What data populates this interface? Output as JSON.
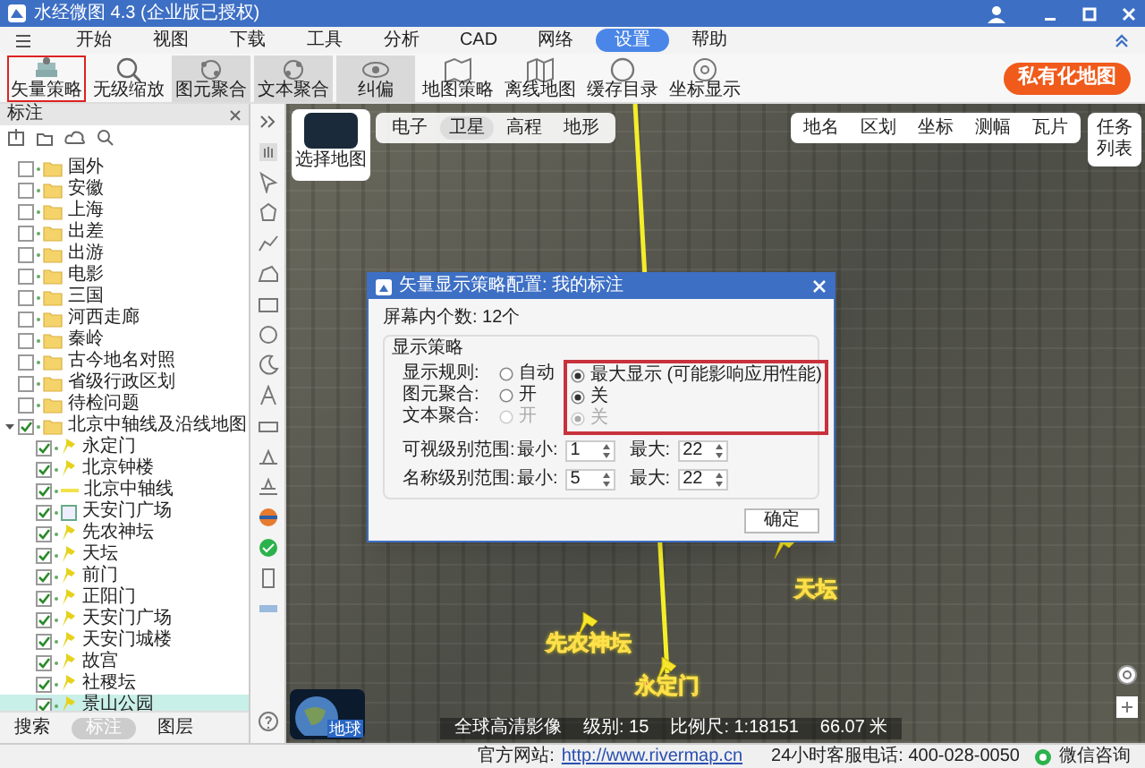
{
  "window": {
    "title": "水经微图 4.3 (企业版已授权)"
  },
  "menu": [
    {
      "label": "开始",
      "selected": false
    },
    {
      "label": "视图",
      "selected": false
    },
    {
      "label": "下载",
      "selected": false
    },
    {
      "label": "工具",
      "selected": false
    },
    {
      "label": "分析",
      "selected": false
    },
    {
      "label": "CAD",
      "selected": false
    },
    {
      "label": "网络",
      "selected": false
    },
    {
      "label": "设置",
      "selected": true
    },
    {
      "label": "帮助",
      "selected": false
    }
  ],
  "toolbar": [
    {
      "label": "矢量策略",
      "selected": true,
      "on": false
    },
    {
      "label": "无级缩放",
      "selected": false,
      "on": false
    },
    {
      "label": "图元聚合",
      "selected": false,
      "on": true
    },
    {
      "label": "文本聚合",
      "selected": false,
      "on": true
    },
    {
      "label": "纠偏",
      "selected": false,
      "on": true
    },
    {
      "label": "地图策略",
      "selected": false,
      "on": false
    },
    {
      "label": "离线地图",
      "selected": false,
      "on": false
    },
    {
      "label": "缓存目录",
      "selected": false,
      "on": false
    },
    {
      "label": "坐标显示",
      "selected": false,
      "on": false
    }
  ],
  "private_map_button": "私有化地图",
  "sidebar": {
    "title": "标注",
    "tree": [
      {
        "label": "国外",
        "kind": "folder",
        "checked": false
      },
      {
        "label": "安徽",
        "kind": "folder",
        "checked": false
      },
      {
        "label": "上海",
        "kind": "folder",
        "checked": false
      },
      {
        "label": "出差",
        "kind": "folder",
        "checked": false
      },
      {
        "label": "出游",
        "kind": "folder",
        "checked": false
      },
      {
        "label": "电影",
        "kind": "folder",
        "checked": false
      },
      {
        "label": "三国",
        "kind": "folder",
        "checked": false
      },
      {
        "label": "河西走廊",
        "kind": "folder",
        "checked": false
      },
      {
        "label": "秦岭",
        "kind": "folder",
        "checked": false
      },
      {
        "label": "古今地名对照",
        "kind": "folder",
        "checked": false
      },
      {
        "label": "省级行政区划",
        "kind": "folder",
        "checked": false
      },
      {
        "label": "待检问题",
        "kind": "folder",
        "checked": false
      },
      {
        "label": "北京中轴线及沿线地图",
        "kind": "folder",
        "checked": true,
        "expanded": true,
        "children": [
          {
            "label": "永定门",
            "kind": "point",
            "checked": true,
            "selected": false
          },
          {
            "label": "北京钟楼",
            "kind": "point",
            "checked": true,
            "selected": false
          },
          {
            "label": "北京中轴线",
            "kind": "line",
            "checked": true,
            "selected": false
          },
          {
            "label": "天安门广场",
            "kind": "polygon",
            "checked": true,
            "selected": false
          },
          {
            "label": "先农神坛",
            "kind": "point",
            "checked": true,
            "selected": false
          },
          {
            "label": "天坛",
            "kind": "point",
            "checked": true,
            "selected": false
          },
          {
            "label": "前门",
            "kind": "point",
            "checked": true,
            "selected": false
          },
          {
            "label": "正阳门",
            "kind": "point",
            "checked": true,
            "selected": false
          },
          {
            "label": "天安门广场",
            "kind": "point",
            "checked": true,
            "selected": false
          },
          {
            "label": "天安门城楼",
            "kind": "point",
            "checked": true,
            "selected": false
          },
          {
            "label": "故宫",
            "kind": "point",
            "checked": true,
            "selected": false
          },
          {
            "label": "社稷坛",
            "kind": "point",
            "checked": true,
            "selected": false
          },
          {
            "label": "景山公园",
            "kind": "point",
            "checked": true,
            "selected": true
          }
        ]
      }
    ],
    "tabs": [
      {
        "label": "搜索",
        "selected": false
      },
      {
        "label": "标注",
        "selected": true
      },
      {
        "label": "图层",
        "selected": false
      }
    ]
  },
  "map": {
    "thumbnail_label": "选择地图",
    "base_types": [
      {
        "label": "电子",
        "selected": false
      },
      {
        "label": "卫星",
        "selected": true
      },
      {
        "label": "高程",
        "selected": false
      },
      {
        "label": "地形",
        "selected": false
      }
    ],
    "tools": [
      "地名",
      "区划",
      "坐标",
      "测幅",
      "瓦片"
    ],
    "task_list": "任务列表",
    "markers": [
      {
        "label": "天坛"
      },
      {
        "label": "先农神坛"
      },
      {
        "label": "永定门"
      }
    ],
    "globe_label": "地球",
    "status": [
      "全球高清影像",
      "级别: 15",
      "比例尺: 1:18151",
      "66.07 米"
    ]
  },
  "dialog": {
    "title": "矢量显示策略配置: 我的标注",
    "count": "屏幕内个数: 12个",
    "group": "显示策略",
    "rows": [
      {
        "label": "显示规则:",
        "disabled": false,
        "options": [
          {
            "label": "自动",
            "selected": false
          },
          {
            "label": "最大显示 (可能影响应用性能)",
            "selected": true
          }
        ]
      },
      {
        "label": "图元聚合:",
        "disabled": false,
        "options": [
          {
            "label": "开",
            "selected": false
          },
          {
            "label": "关",
            "selected": true
          }
        ]
      },
      {
        "label": "文本聚合:",
        "disabled": true,
        "options": [
          {
            "label": "开",
            "selected": false
          },
          {
            "label": "关",
            "selected": true
          }
        ]
      }
    ],
    "ranges": [
      {
        "label": "可视级别范围:",
        "min_label": "最小:",
        "min": "1",
        "max_label": "最大:",
        "max": "22"
      },
      {
        "label": "名称级别范围:",
        "min_label": "最小:",
        "min": "5",
        "max_label": "最大:",
        "max": "22"
      }
    ],
    "ok": "确定"
  },
  "status_bar": {
    "site_label": "官方网站:",
    "site_link": "http://www.rivermap.cn",
    "hotline": "24小时客服电话: 400-028-0050",
    "wechat": "微信咨询"
  }
}
